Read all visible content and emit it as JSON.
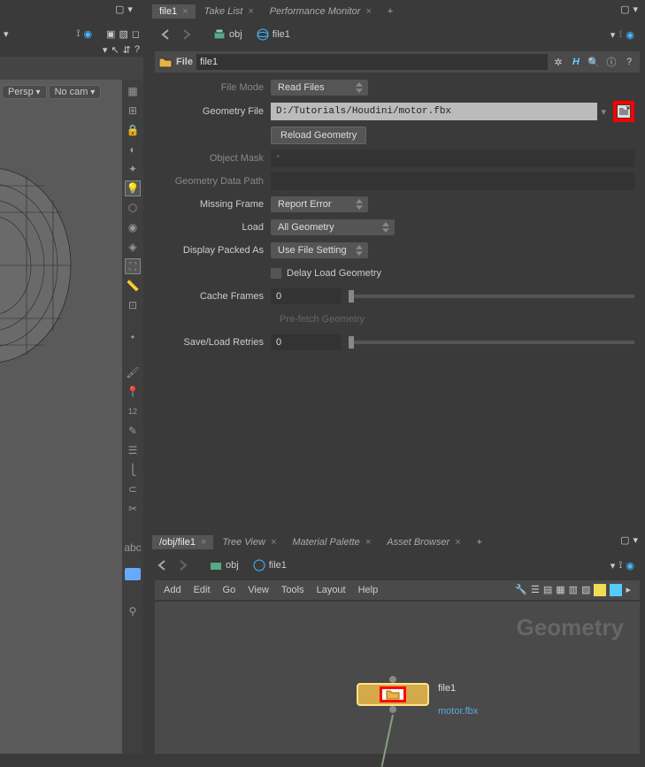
{
  "top_tabs": {
    "file1": "file1",
    "take_list": "Take List",
    "perf_mon": "Performance Monitor"
  },
  "path": {
    "obj": "obj",
    "file1": "file1"
  },
  "node_header": {
    "type_label": "File",
    "name": "file1"
  },
  "params": {
    "file_mode_label": "File Mode",
    "file_mode_value": "Read Files",
    "geometry_file_label": "Geometry File",
    "geometry_file_value": "D:/Tutorials/Houdini/motor.fbx",
    "reload_geometry_label": "Reload Geometry",
    "object_mask_label": "Object Mask",
    "object_mask_value": "*",
    "geometry_data_path_label": "Geometry Data Path",
    "missing_frame_label": "Missing Frame",
    "missing_frame_value": "Report Error",
    "load_label": "Load",
    "load_value": "All Geometry",
    "display_packed_label": "Display Packed As",
    "display_packed_value": "Use File Setting",
    "delay_load_label": "Delay Load Geometry",
    "cache_frames_label": "Cache Frames",
    "cache_frames_value": "0",
    "prefetch_label": "Pre-fetch Geometry",
    "save_load_label": "Save/Load Retries",
    "save_load_value": "0"
  },
  "viewport": {
    "persp": "Persp",
    "nocam": "No cam",
    "abc": "abc"
  },
  "net_tabs": {
    "path": "/obj/file1",
    "tree": "Tree View",
    "mat": "Material Palette",
    "asset": "Asset Browser"
  },
  "net_menu": {
    "add": "Add",
    "edit": "Edit",
    "go": "Go",
    "view": "View",
    "tools": "Tools",
    "layout": "Layout",
    "help": "Help"
  },
  "net_canvas": {
    "title": "Geometry",
    "node_label": "file1",
    "node_sub": "motor.fbx"
  }
}
